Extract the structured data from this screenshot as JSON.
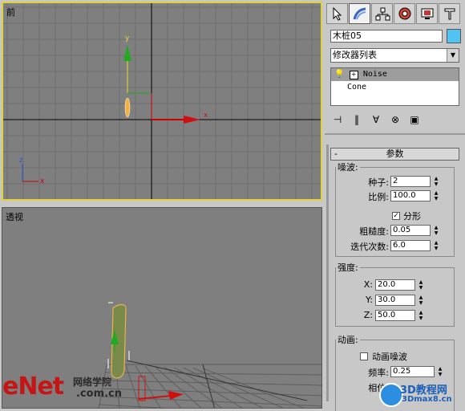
{
  "viewports": {
    "front": {
      "label": "前"
    },
    "perspective": {
      "label": "透视"
    },
    "axes": {
      "x": "x",
      "y": "y",
      "z": "z"
    }
  },
  "panel": {
    "tabs": [
      "create-icon",
      "modify-icon",
      "hierarchy-icon",
      "motion-icon",
      "display-icon",
      "utilities-icon"
    ],
    "object_name": "木桩05",
    "object_color": "#51c3f2",
    "modifier_list": "修改器列表",
    "stack": [
      {
        "label": "Noise",
        "selected": true
      },
      {
        "label": "Cone",
        "selected": false
      }
    ],
    "rollout_title": "参数",
    "noise_group": {
      "title": "噪波:",
      "seed_label": "种子:",
      "seed_value": "2",
      "scale_label": "比例:",
      "scale_value": "100.0",
      "fractal_label": "分形",
      "fractal_checked": true,
      "roughness_label": "粗糙度:",
      "roughness_value": "0.05",
      "iterations_label": "迭代次数:",
      "iterations_value": "6.0"
    },
    "strength_group": {
      "title": "强度:",
      "x_label": "X:",
      "x_value": "20.0",
      "y_label": "Y:",
      "y_value": "30.0",
      "z_label": "Z:",
      "z_value": "50.0"
    },
    "animation_group": {
      "title": "动画:",
      "animate_label": "动画噪波",
      "animate_checked": false,
      "frequency_label": "频率:",
      "frequency_value": "0.25",
      "phase_label": "相位:"
    }
  },
  "watermarks": {
    "left_brand": "eNet",
    "left_sub": "网络学院",
    "left_url": ".com.cn",
    "right_brand": "3D教程网",
    "right_url": "3Dmax8.cn"
  }
}
